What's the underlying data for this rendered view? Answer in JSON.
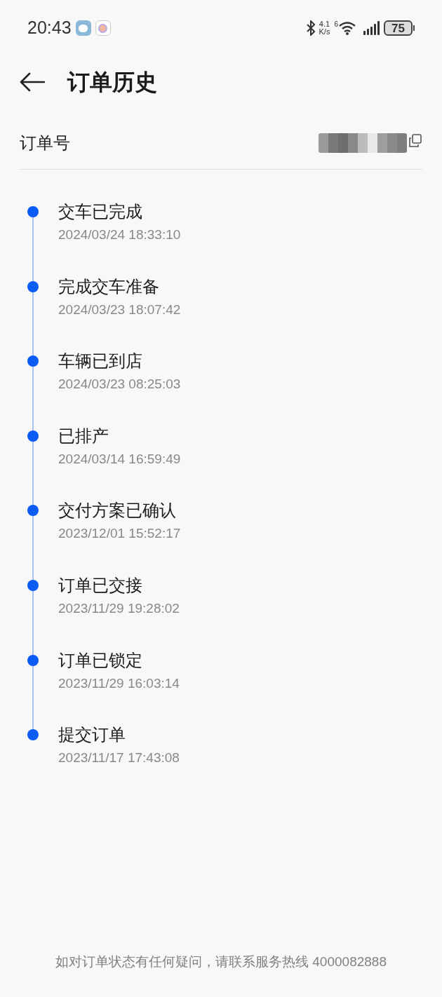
{
  "status_bar": {
    "time": "20:43",
    "speed_value": "4.1",
    "speed_unit": "K/s",
    "wifi_badge": "6",
    "battery": "75"
  },
  "header": {
    "title": "订单历史"
  },
  "order": {
    "label": "订单号"
  },
  "timeline": [
    {
      "title": "交车已完成",
      "time": "2024/03/24 18:33:10"
    },
    {
      "title": "完成交车准备",
      "time": "2024/03/23 18:07:42"
    },
    {
      "title": "车辆已到店",
      "time": "2024/03/23 08:25:03"
    },
    {
      "title": "已排产",
      "time": "2024/03/14 16:59:49"
    },
    {
      "title": "交付方案已确认",
      "time": "2023/12/01 15:52:17"
    },
    {
      "title": "订单已交接",
      "time": "2023/11/29 19:28:02"
    },
    {
      "title": "订单已锁定",
      "time": "2023/11/29 16:03:14"
    },
    {
      "title": "提交订单",
      "time": "2023/11/17 17:43:08"
    }
  ],
  "footer": {
    "text": "如对订单状态有任何疑问，请联系服务热线 4000082888"
  }
}
